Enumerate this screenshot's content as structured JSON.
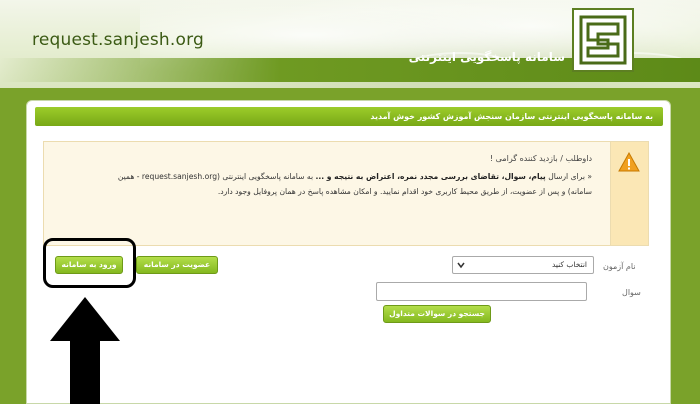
{
  "header": {
    "site_url": "request.sanjesh.org",
    "site_title": "سامانه پاسخگویی اینترنتی",
    "logo_icon": "sanjesh-logo-icon"
  },
  "panel": {
    "title": "به سامانه پاسخگویی اینترنتی سازمان سنجش آموزش کشور خوش آمدید"
  },
  "notice": {
    "greeting": "داوطلب / بازدید کننده گرامی !",
    "line1_prefix": "« برای ارسال ",
    "line1_bold": "پیام، سوال، تقاضای بررسی مجدد نمره، اعتراض به نتیجه و ...",
    "line1_suffix": " به سامانه پاسخگویی اینترنتی (request.sanjesh.org - همین سامانه) و پس از عضویت، از طریق محیط کاربری خود اقدام نمایید. و امکان مشاهده پاسخ در همان پروفایل وجود دارد.",
    "icon": "warning-icon"
  },
  "buttons": {
    "login": "ورود به سامانه",
    "register": "عضویت در سامانه",
    "search": "جستجو در سوالات متداول"
  },
  "form": {
    "exam_label": "نام آزمون",
    "exam_selected": "انتخاب کنید",
    "question_label": "سوال",
    "question_value": ""
  },
  "colors": {
    "background": "#7aa22a",
    "button": "#84b81f",
    "panel_header": "#78a816"
  }
}
